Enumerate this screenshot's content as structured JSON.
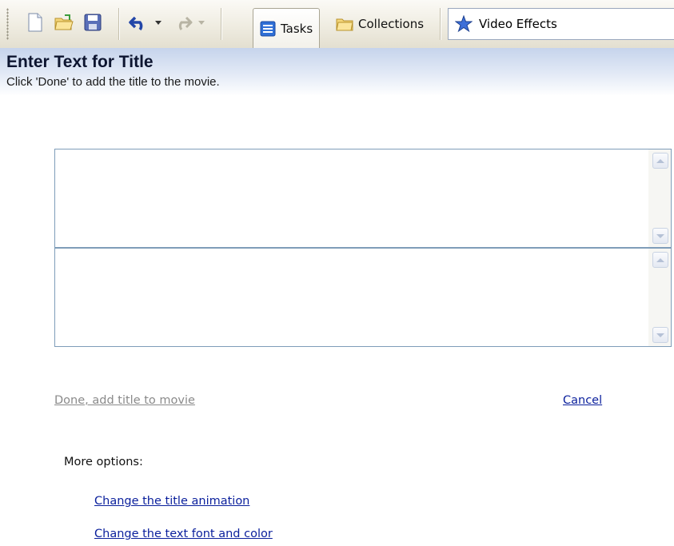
{
  "toolbar": {
    "tabs": [
      {
        "label": "Tasks",
        "icon": "tasks-icon"
      },
      {
        "label": "Collections",
        "icon": "folder-icon"
      }
    ],
    "effects_dropdown": {
      "value": "Video Effects",
      "icon": "star-icon"
    }
  },
  "panel": {
    "title": "Enter Text for Title",
    "subtitle": "Click 'Done' to add the title to the movie."
  },
  "inputs": {
    "title_text": "",
    "subtitle_text": ""
  },
  "actions": {
    "done": "Done, add title to movie",
    "cancel": "Cancel"
  },
  "options": {
    "heading": "More options:",
    "items": [
      "Change the title animation",
      "Change the text font and color"
    ]
  },
  "colors": {
    "link": "#0a1f9c",
    "disabled_link": "#8a8a8a",
    "header_gradient_top": "#c6d4ec"
  }
}
